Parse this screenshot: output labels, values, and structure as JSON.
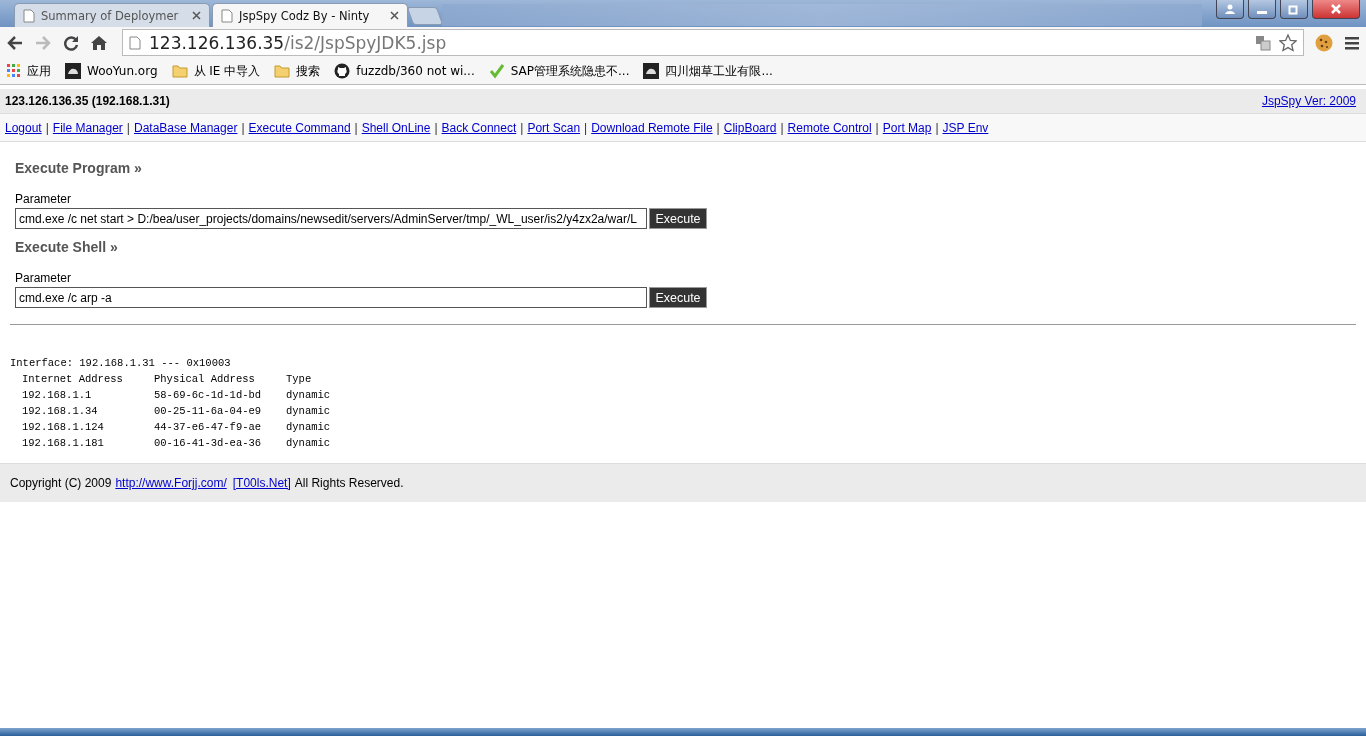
{
  "browser": {
    "tabs": [
      {
        "title": "Summary of Deploymer",
        "selected": false
      },
      {
        "title": "JspSpy Codz By - Ninty",
        "selected": true
      }
    ],
    "address": {
      "host": "123.126.136.35",
      "path": "/is2/JspSpyJDK5.jsp"
    },
    "bookmarks": [
      {
        "kind": "apps",
        "label": "应用"
      },
      {
        "kind": "site",
        "label": "WooYun.org"
      },
      {
        "kind": "folder",
        "label": "从 IE 中导入"
      },
      {
        "kind": "folder",
        "label": "搜索"
      },
      {
        "kind": "github",
        "label": "fuzzdb/360 not wi..."
      },
      {
        "kind": "check",
        "label": "SAP管理系统隐患不..."
      },
      {
        "kind": "site",
        "label": "四川烟草工业有限..."
      }
    ]
  },
  "header": {
    "host": "123.126.136.35 (192.168.1.31)",
    "version_link": "JspSpy Ver: 2009"
  },
  "nav": {
    "separator": "|",
    "links": [
      "Logout",
      "File Manager",
      "DataBase Manager",
      "Execute Command",
      "Shell OnLine",
      "Back Connect",
      "Port Scan",
      "Download Remote File",
      "ClipBoard",
      "Remote Control",
      "Port Map",
      "JSP Env"
    ]
  },
  "sections": [
    {
      "title": "Execute Program",
      "marker": "»",
      "label": "Parameter",
      "value": "cmd.exe /c net start > D:/bea/user_projects/domains/newsedit/servers/AdminServer/tmp/_WL_user/is2/y4zx2a/war/L",
      "button": "Execute"
    },
    {
      "title": "Execute Shell",
      "marker": "»",
      "label": "Parameter",
      "value": "cmd.exe /c arp -a",
      "button": "Execute"
    }
  ],
  "output": {
    "interface": "Interface: 192.168.1.31 --- 0x10003",
    "columns": [
      "Internet Address",
      "Physical Address",
      "Type"
    ],
    "rows": [
      [
        "192.168.1.1",
        "58-69-6c-1d-1d-bd",
        "dynamic"
      ],
      [
        "192.168.1.34",
        "00-25-11-6a-04-e9",
        "dynamic"
      ],
      [
        "192.168.1.124",
        "44-37-e6-47-f9-ae",
        "dynamic"
      ],
      [
        "192.168.1.181",
        "00-16-41-3d-ea-36",
        "dynamic"
      ]
    ]
  },
  "footer": {
    "before": "Copyright (C) 2009",
    "link1": "http://www.Forjj.com/",
    "link2": "[T00ls.Net]",
    "after": "All Rights Reserved."
  }
}
